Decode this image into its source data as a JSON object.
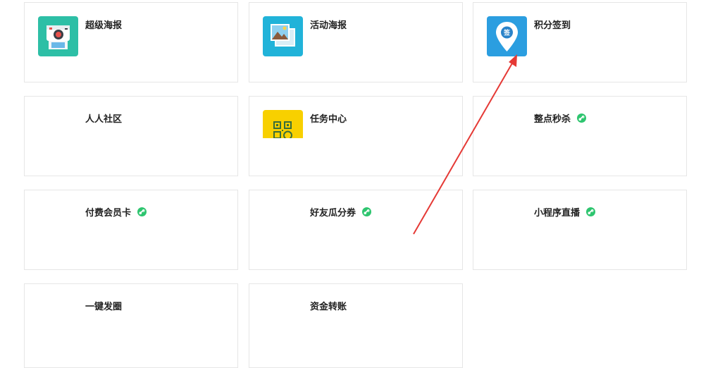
{
  "cards": [
    {
      "title": "超级海报",
      "icon": "super-poster-icon",
      "color": "#2dbfa6"
    },
    {
      "title": "活动海报",
      "icon": "activity-poster-icon",
      "color": "#21b3d9"
    },
    {
      "title": "积分签到",
      "icon": "points-signin-icon",
      "color": "#2b9ee0",
      "badge_text": "签"
    },
    {
      "title": "人人社区"
    },
    {
      "title": "任务中心",
      "icon": "task-center-qr-icon",
      "color": "#f8d000"
    },
    {
      "title": "整点秒杀",
      "mini_program": true
    },
    {
      "title": "付费会员卡",
      "mini_program": true
    },
    {
      "title": "好友瓜分券",
      "mini_program": true
    },
    {
      "title": "小程序直播",
      "mini_program": true
    },
    {
      "title": "一键发圈"
    },
    {
      "title": "资金转账"
    }
  ],
  "colors": {
    "border": "#e6e6e6",
    "mini_program_badge": "#2ec56f",
    "annotation_arrow": "#e53935"
  }
}
